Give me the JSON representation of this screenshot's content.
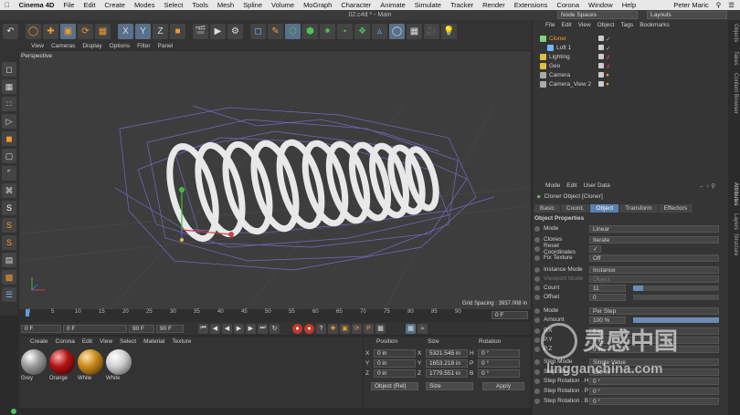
{
  "menubar": {
    "items": [
      "Cinema 4D",
      "File",
      "Edit",
      "Create",
      "Modes",
      "Select",
      "Tools",
      "Mesh",
      "Spline",
      "Volume",
      "MoGraph",
      "Character",
      "Animate",
      "Simulate",
      "Tracker",
      "Render",
      "Extensions",
      "Corona",
      "Window",
      "Help"
    ],
    "user": "Peter Maric",
    "layout_label": "Layouts",
    "node_spaces": "Node Spaces"
  },
  "titlebar": {
    "title": "02.c4d * - Main"
  },
  "viewport": {
    "menu": [
      "View",
      "Cameras",
      "Display",
      "Options",
      "Filter",
      "Panel"
    ],
    "label": "Perspective",
    "grid_spacing": "Grid Spacing : 3937.008 in"
  },
  "timeline": {
    "ticks": [
      "0",
      "5",
      "10",
      "15",
      "20",
      "25",
      "30",
      "35",
      "40",
      "45",
      "50",
      "55",
      "60",
      "65",
      "70",
      "75",
      "80",
      "85",
      "90"
    ],
    "end_field": "0 F"
  },
  "transport": {
    "start": "0 F",
    "current": "0 F",
    "end": "90 F",
    "end2": "90 F"
  },
  "materials": {
    "menu": [
      "Create",
      "Corona",
      "Edit",
      "View",
      "Select",
      "Material",
      "Texture"
    ],
    "items": [
      {
        "name": "Grey",
        "color": "#9a9a9a"
      },
      {
        "name": "Orange",
        "color": "#b11414"
      },
      {
        "name": "White",
        "color": "#c98a1e"
      },
      {
        "name": "White",
        "color": "#cfcfcf"
      }
    ]
  },
  "coords": {
    "headers": [
      "Position",
      "Size",
      "Rotation"
    ],
    "rows": [
      {
        "axis": "X",
        "pos": "0 in",
        "sz": "X",
        "size": "5321.545 in",
        "rl": "H",
        "rot": "0 °"
      },
      {
        "axis": "Y",
        "pos": "0 in",
        "sz": "Y",
        "size": "1653.218 in",
        "rl": "P",
        "rot": "0 °"
      },
      {
        "axis": "Z",
        "pos": "0 in",
        "sz": "Z",
        "size": "1779.551 in",
        "rl": "B",
        "rot": "0 °"
      }
    ],
    "mode1": "Object (Rel)",
    "mode2": "Size",
    "apply": "Apply"
  },
  "objmgr": {
    "menu": [
      "File",
      "Edit",
      "View",
      "Object",
      "Tags",
      "Bookmarks"
    ],
    "objects": [
      {
        "name": "Cloner",
        "color": "#7fd27f"
      },
      {
        "name": "Loft 1",
        "color": "#6fb6ff"
      },
      {
        "name": "Lighting",
        "color": "#e0c040"
      },
      {
        "name": "Geo",
        "color": "#e0c040"
      },
      {
        "name": "Camera",
        "color": "#aaaaaa"
      },
      {
        "name": "Camera_View 2",
        "color": "#aaaaaa"
      }
    ]
  },
  "attributes": {
    "menu": [
      "Mode",
      "Edit",
      "User Data"
    ],
    "object_title": "Cloner Object [Cloner]",
    "tabs": [
      "Basic",
      "Coord.",
      "Object",
      "Transform",
      "Effectors"
    ],
    "section": "Object Properties",
    "rows": [
      {
        "label": "Mode",
        "value": "Linear"
      },
      {
        "label": "Clones",
        "value": "Iterate"
      },
      {
        "label": "Reset Coordinates",
        "value": "✓"
      },
      {
        "label": "Fix Texture",
        "value": "Off"
      },
      {
        "label": "Instance Mode",
        "value": "Instance"
      },
      {
        "label": "Viewport Mode",
        "value": "Object"
      },
      {
        "label": "Count",
        "value": "11"
      },
      {
        "label": "Offset",
        "value": "0"
      },
      {
        "label": "Mode",
        "value": "Per Step"
      },
      {
        "label": "Amount",
        "value": "100 %"
      },
      {
        "label": "P.X",
        "value": "0 in"
      },
      {
        "label": "P.Y",
        "value": "0 in"
      },
      {
        "label": "P.Z",
        "value": "0 in"
      },
      {
        "label": "Step Mode",
        "value": "Single Value"
      },
      {
        "label": "Step Size",
        "value": "100 %"
      },
      {
        "label": "Step Rotation . H",
        "value": "0 °"
      },
      {
        "label": "Step Rotation . P",
        "value": "0 °"
      },
      {
        "label": "Step Rotation . B",
        "value": "0 °"
      }
    ]
  },
  "sidetabs": [
    "Objects",
    "Takes",
    "Content Browser",
    "Attributes",
    "Layers",
    "Structure"
  ],
  "watermark": {
    "cn": "灵感中国",
    "url": "lingganchina.com"
  },
  "colors": {
    "accent": "#5a7fb0",
    "bg": "#2b2b2b"
  }
}
